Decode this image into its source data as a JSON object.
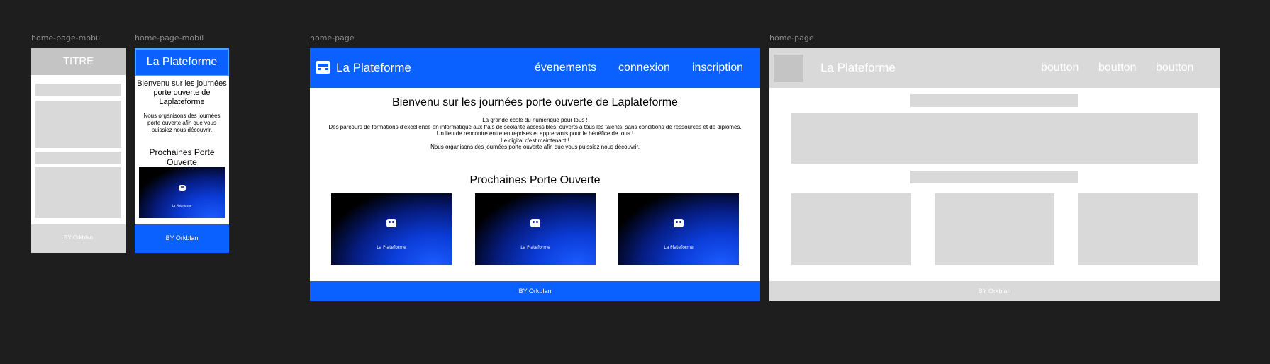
{
  "frames": {
    "mobile_wire": {
      "label": "home-page-mobil",
      "title": "TITRE",
      "footer": "BY Orkblan"
    },
    "mobile": {
      "label": "home-page-mobil",
      "brand": "La Plateforme",
      "heading": "Bienvenu sur les journées porte ouverte de Laplateforme",
      "intro": "Nous organisons des journées porte ouverte afin que vous puissiez nous découvrir.",
      "section_title": "Prochaines Porte Ouverte",
      "card_brand": "La Plateforme",
      "footer": "BY Orkblan"
    },
    "desktop": {
      "label": "home-page",
      "brand": "La Plateforme",
      "nav": [
        "évenements",
        "connexion",
        "inscription"
      ],
      "heading": "Bienvenu sur les journées porte ouverte de Laplateforme",
      "paragraphs": [
        "La grande école du numérique pour tous !",
        "Des parcours de formations d'excellence en informatique aux frais de scolarité accessibles, ouverts à tous les talents, sans conditions de ressources et de diplômes.",
        "Un lieu de rencontre entre entreprises et apprenants pour le bénéfice de tous !",
        "Le digital c'est maintenant !",
        "Nous organisons des journées porte ouverte afin que vous puissiez nous découvrir."
      ],
      "section_title": "Prochaines Porte Ouverte",
      "cards": [
        {
          "brand": "La Plateforme"
        },
        {
          "brand": "La Plateforme"
        },
        {
          "brand": "La Plateforme"
        }
      ],
      "footer": "BY Orkblan"
    },
    "desktop_wire": {
      "label": "home-page",
      "brand": "La Plateforme",
      "nav": [
        "boutton",
        "boutton",
        "boutton"
      ],
      "footer": "BY Orkblan"
    }
  },
  "colors": {
    "canvas": "#1e1e1e",
    "brand_blue": "#0a61ff",
    "wire_gray": "#d9d9d9",
    "wire_header": "#c4c4c4",
    "selection": "#4da3ff"
  }
}
